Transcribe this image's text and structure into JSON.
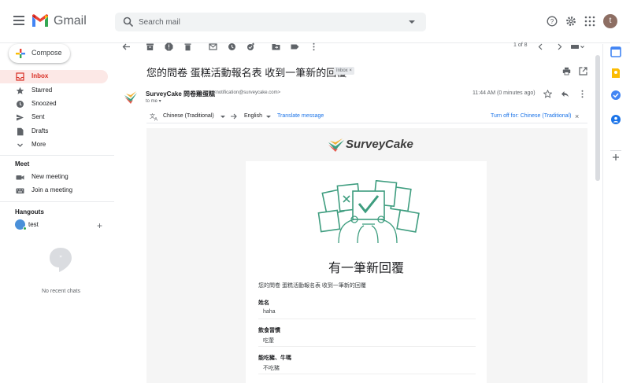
{
  "app": {
    "name": "Gmail"
  },
  "search": {
    "placeholder": "Search mail"
  },
  "user": {
    "avatar_letter": "t"
  },
  "compose": {
    "label": "Compose"
  },
  "nav": [
    {
      "label": "Inbox"
    },
    {
      "label": "Starred"
    },
    {
      "label": "Snoozed"
    },
    {
      "label": "Sent"
    },
    {
      "label": "Drafts"
    },
    {
      "label": "More"
    }
  ],
  "meet": {
    "heading": "Meet",
    "items": [
      {
        "label": "New meeting"
      },
      {
        "label": "Join a meeting"
      }
    ]
  },
  "hangouts": {
    "heading": "Hangouts",
    "user": "test",
    "add": "+",
    "empty": "No recent chats"
  },
  "pager": {
    "text": "1 of 8"
  },
  "message": {
    "subject": "您的問卷 蛋糕活動報名表 收到一筆新的回覆",
    "label": "Inbox ×",
    "sender_name": "SurveyCake 問卷雞蛋糕",
    "sender_email": "<notification@surveycake.com>",
    "to": "to me ▾",
    "time": "11:44 AM (0 minutes ago)"
  },
  "translate": {
    "source": "Chinese (Traditional)",
    "target": "English",
    "action": "Translate message",
    "turn_off": "Turn off for: Chinese (Traditional)",
    "close": "×"
  },
  "email": {
    "brand": "SurveyCake",
    "title": "有一筆新回覆",
    "subtitle": "您的問卷 蛋糕活動報名表 收到一筆新的回覆",
    "fields": [
      {
        "label": "姓名",
        "value": "haha"
      },
      {
        "label": "飲食習慣",
        "value": "吃葷"
      },
      {
        "label": "能吃豬、牛嗎",
        "value": "不吃豬"
      }
    ]
  },
  "colors": {
    "accent_red": "#d93025",
    "brand_green": "#3e9d7f",
    "link_blue": "#1a73e8",
    "active_bg": "#fce8e6"
  }
}
